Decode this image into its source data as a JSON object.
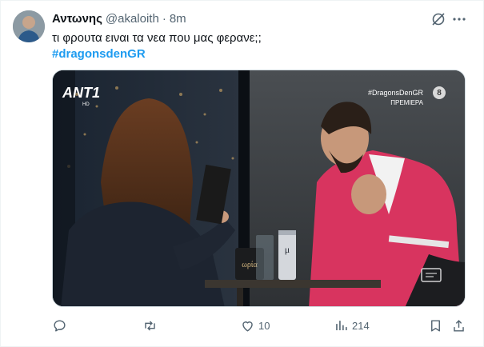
{
  "tweet": {
    "author": {
      "display_name": "Αντωνης",
      "handle": "@akaloith",
      "separator": "·",
      "time": "8m"
    },
    "text": "τι φρουτα ειναι τα νεα που μας φερανε;;",
    "hashtag": "#dragonsdenGR",
    "media": {
      "channel_logo": "ANT1",
      "channel_logo_sub": "HD",
      "overlay_hashtag": "#DragonsDenGR",
      "overlay_label": "ΠΡΕΜΙΕΡΑ",
      "rating_badge": "8",
      "mug_text": "ωρία",
      "can_text": "μ"
    },
    "actions": {
      "reply_count": "",
      "retweet_count": "",
      "like_count": "10",
      "views_count": "214"
    },
    "icons": {
      "grok": "grok-icon",
      "more": "more-icon",
      "reply": "reply-icon",
      "retweet": "retweet-icon",
      "like": "heart-icon",
      "views": "views-icon",
      "bookmark": "bookmark-icon",
      "share": "share-icon"
    },
    "colors": {
      "accent": "#1d9bf0",
      "secondary_text": "#536471",
      "primary_text": "#0f1419"
    }
  }
}
